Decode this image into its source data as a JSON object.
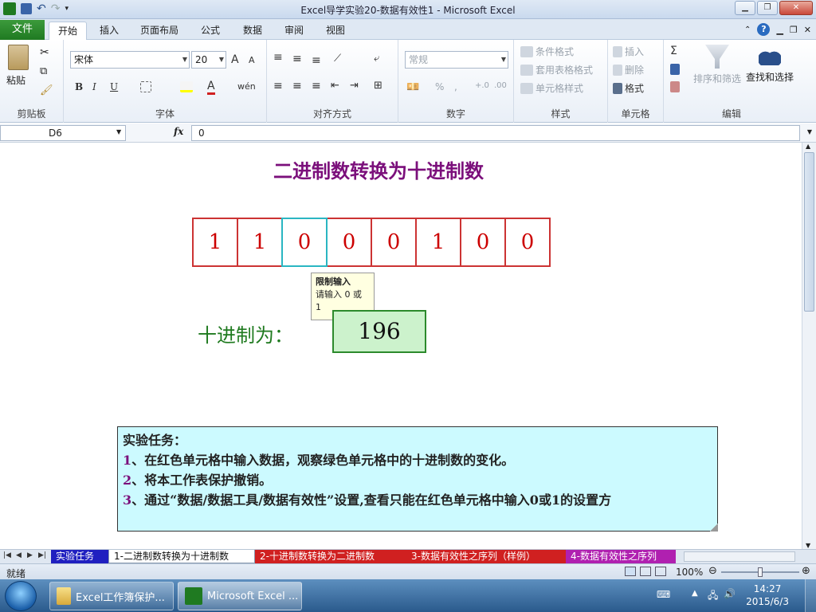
{
  "window": {
    "title": "Excel导学实验20-数据有效性1 - Microsoft Excel"
  },
  "ribbon": {
    "file_tab": "文件",
    "tabs": [
      "开始",
      "插入",
      "页面布局",
      "公式",
      "数据",
      "审阅",
      "视图"
    ],
    "active_tab": "开始",
    "clipboard": {
      "paste": "粘贴",
      "label": "剪贴板"
    },
    "font": {
      "name": "宋体",
      "size": "20",
      "label": "字体",
      "bold": "B",
      "italic": "I",
      "underline": "U",
      "grow": "A",
      "shrink": "A",
      "color_a": "A",
      "phonetic": "wén"
    },
    "alignment": {
      "label": "对齐方式"
    },
    "number": {
      "format": "常规",
      "label": "数字"
    },
    "styles": {
      "conditional": "条件格式",
      "table": "套用表格格式",
      "cell": "单元格样式",
      "label": "样式"
    },
    "cells": {
      "insert": "插入",
      "delete": "删除",
      "format": "格式",
      "label": "单元格"
    },
    "editing": {
      "sort": "排序和筛选",
      "find": "查找和选择",
      "label": "编辑",
      "sum": "Σ"
    }
  },
  "formula_bar": {
    "name_box": "D6",
    "fx": "fx",
    "value": "0"
  },
  "sheet": {
    "title": "二进制数转换为十进制数",
    "bits": [
      "1",
      "1",
      "0",
      "0",
      "0",
      "1",
      "0",
      "0"
    ],
    "tooltip": {
      "title": "限制输入",
      "body": "请输入 0 或 1"
    },
    "decimal_label": "十进制为：",
    "decimal_value": "196",
    "task": {
      "heading": "实验任务：",
      "items": [
        {
          "num": "1",
          "text": "、在红色单元格中输入数据，观察绿色单元格中的十进制数的变化。"
        },
        {
          "num": "2",
          "text": "、将本工作表保护撤销。"
        },
        {
          "num": "3",
          "text": "、通过“数据/数据工具/数据有效性”设置,查看只能在红色单元格中输入0或1的设置方"
        }
      ]
    }
  },
  "sheet_tabs": [
    {
      "label": "实验任务",
      "color": "#2020c0"
    },
    {
      "label": "1-二进制数转换为十进制数",
      "color": "#ffffff"
    },
    {
      "label": "2-十进制数转换为二进制数",
      "color": "#d02020"
    },
    {
      "label": "3-数据有效性之序列（样例）",
      "color": "#d02020"
    },
    {
      "label": "4-数据有效性之序列",
      "color": "#b020b0"
    }
  ],
  "status": {
    "ready": "就绪",
    "zoom": "100%"
  },
  "taskbar": {
    "items": [
      {
        "label": "Excel工作簿保护..."
      },
      {
        "label": "Microsoft Excel ..."
      }
    ],
    "time": "14:27",
    "date": "2015/6/3"
  },
  "colors": {
    "title": "#7b0f7b",
    "bit_border": "#cc3333",
    "bit_text": "#cc0000",
    "decimal_fill": "#ccf2cc",
    "task_fill": "#ccfaff"
  }
}
